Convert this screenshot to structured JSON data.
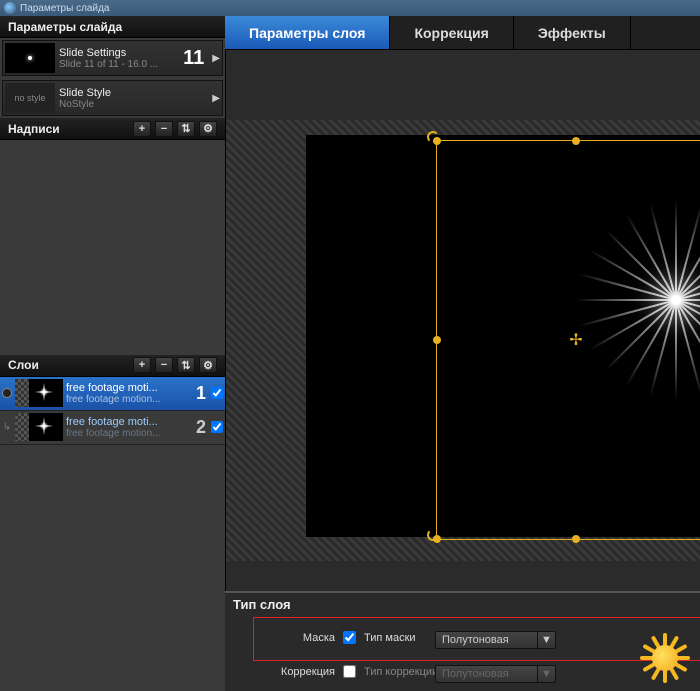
{
  "window": {
    "title": "Параметры слайда"
  },
  "sidebar": {
    "params_header": "Параметры слайда",
    "slide_settings": {
      "title": "Slide Settings",
      "sub": "Slide 11 of 11 - 16.0 ...",
      "num": "11"
    },
    "slide_style": {
      "thumb_text": "no style",
      "title": "Slide Style",
      "sub": "NoStyle"
    },
    "captions_header": "Надписи",
    "layers_header": "Слои",
    "layers": [
      {
        "title": "free footage moti...",
        "sub": "free footage motion...",
        "num": "1",
        "checked": true,
        "selected": true
      },
      {
        "title": "free footage moti...",
        "sub": "free footage motion...",
        "num": "2",
        "checked": true,
        "selected": false
      }
    ]
  },
  "tabs": {
    "layer_params": "Параметры слоя",
    "correction": "Коррекция",
    "effects": "Эффекты"
  },
  "bottom": {
    "section_title": "Тип слоя",
    "mask_label": "Маска",
    "mask_type_label": "Тип маски",
    "mask_type_value": "Полутоновая",
    "correction_label": "Коррекция",
    "correction_type_label": "Тип коррекции",
    "correction_value": "Полутоновая"
  }
}
